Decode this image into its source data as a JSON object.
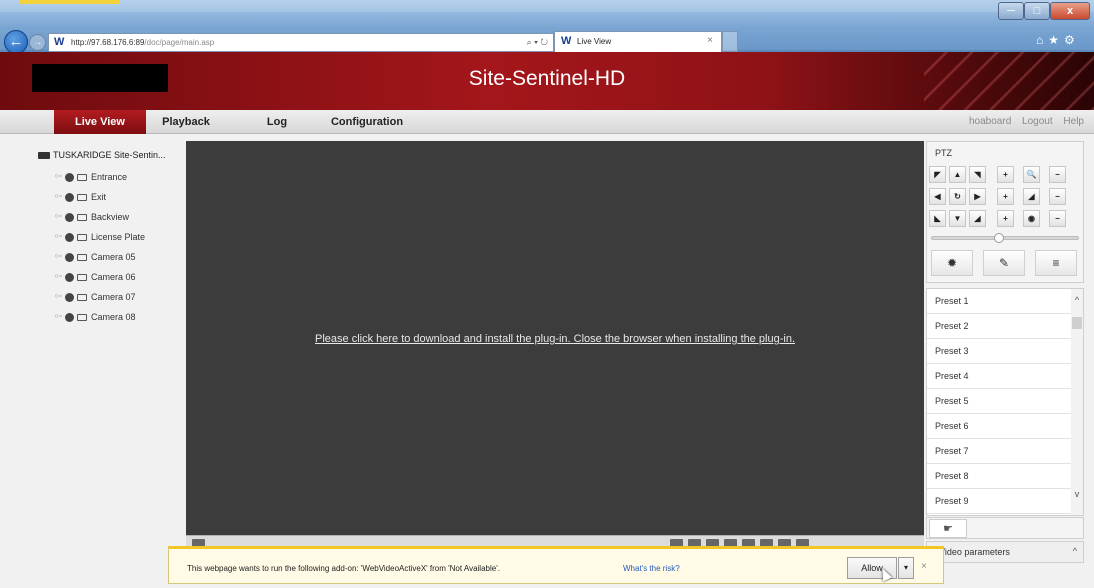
{
  "browser": {
    "url_main": "http://97.68.176.6:89",
    "url_rest": "/doc/page/main.asp",
    "address_tools": "⌕ ▾ ↻",
    "tab_title": "Live View",
    "tab_close": "×",
    "window_controls": {
      "min": "─",
      "max": "□",
      "close": "x"
    },
    "right_icons": "⌂★⚙"
  },
  "app": {
    "title": "Site-Sentinel-HD",
    "accent": "#a4161b"
  },
  "nav": {
    "items": [
      {
        "label": "Live View",
        "active": true
      },
      {
        "label": "Playback"
      },
      {
        "label": "Log"
      },
      {
        "label": "Configuration"
      }
    ],
    "links": [
      "hoaboard",
      "Logout",
      "Help"
    ]
  },
  "tree": {
    "root": "TUSKARIDGE Site-Sentin...",
    "cameras": [
      "Entrance",
      "Exit",
      "Backview",
      "License Plate",
      "Camera 05",
      "Camera 06",
      "Camera 07",
      "Camera 08"
    ]
  },
  "video": {
    "plugin_message": "Please click here to download and install the plug-in. Close the browser when installing the plug-in."
  },
  "ptz": {
    "title": "PTZ",
    "grid": [
      [
        "◤",
        "▲",
        "◥",
        "+",
        "🔍",
        "−"
      ],
      [
        "◀",
        "↻",
        "▶",
        "+",
        "◢",
        "−"
      ],
      [
        "◣",
        "▼",
        "◢",
        "+",
        "◉",
        "−"
      ]
    ],
    "slider_level": 0.45,
    "big_buttons": [
      "✹",
      "✎",
      "≡"
    ]
  },
  "presets": {
    "items": [
      "Preset 1",
      "Preset 2",
      "Preset 3",
      "Preset 4",
      "Preset 5",
      "Preset 6",
      "Preset 7",
      "Preset 8",
      "Preset 9"
    ],
    "scroll_up": "^",
    "scroll_down": "v",
    "call_icon": "☛"
  },
  "video_params": {
    "label": "Video parameters",
    "chevron": "^"
  },
  "infobar": {
    "message": "This webpage wants to run the following add-on: 'WebVideoActiveX' from 'Not Available'.",
    "risk_link": "What's the risk?",
    "allow_label": "Allow",
    "drop_label": "▾",
    "close_label": "×"
  }
}
